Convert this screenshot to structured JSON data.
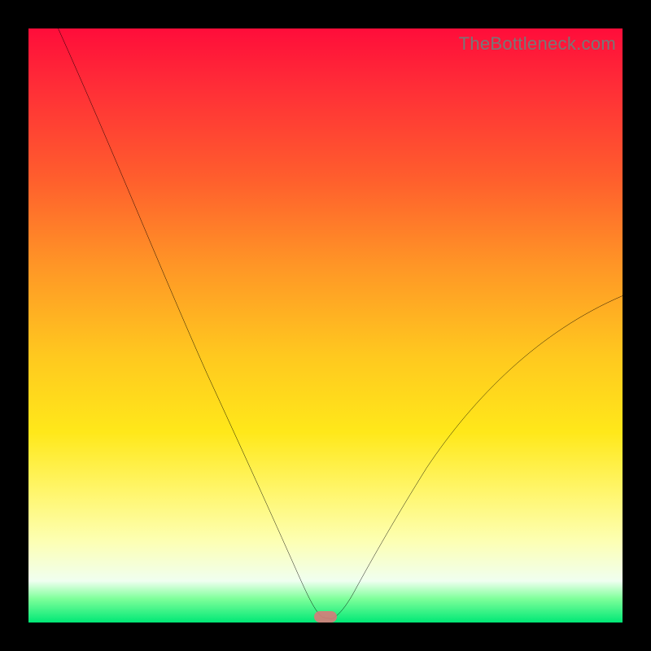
{
  "watermark": "TheBottleneck.com",
  "colors": {
    "frame_border": "#000000",
    "curve_stroke": "#000000",
    "marker_fill": "#d87a7a",
    "gradient_top": "#ff0d3a",
    "gradient_bottom": "#00e876"
  },
  "chart_data": {
    "type": "line",
    "title": "",
    "xlabel": "",
    "ylabel": "",
    "xlim": [
      0,
      100
    ],
    "ylim": [
      0,
      100
    ],
    "grid": false,
    "legend": false,
    "x": [
      0,
      3,
      6,
      10,
      14,
      18,
      22,
      26,
      30,
      34,
      38,
      42,
      44,
      46,
      47.5,
      49,
      50.5,
      52,
      55,
      58,
      62,
      66,
      70,
      74,
      78,
      82,
      86,
      90,
      94,
      98,
      100
    ],
    "values": [
      100,
      94,
      88,
      80,
      72,
      64,
      56,
      48,
      40,
      32,
      24,
      16,
      11,
      6,
      3,
      1,
      0.5,
      1,
      3,
      6,
      10,
      15,
      20,
      25,
      30,
      35,
      40,
      45,
      49,
      53,
      55
    ],
    "annotations": [
      {
        "type": "marker",
        "x": 50,
        "y": 0.5,
        "shape": "pill",
        "color": "#d87a7a"
      }
    ],
    "notes": "V-shaped bottleneck curve on a red→green vertical gradient; minimum near x≈50. No axis ticks or numeric labels are visible."
  }
}
